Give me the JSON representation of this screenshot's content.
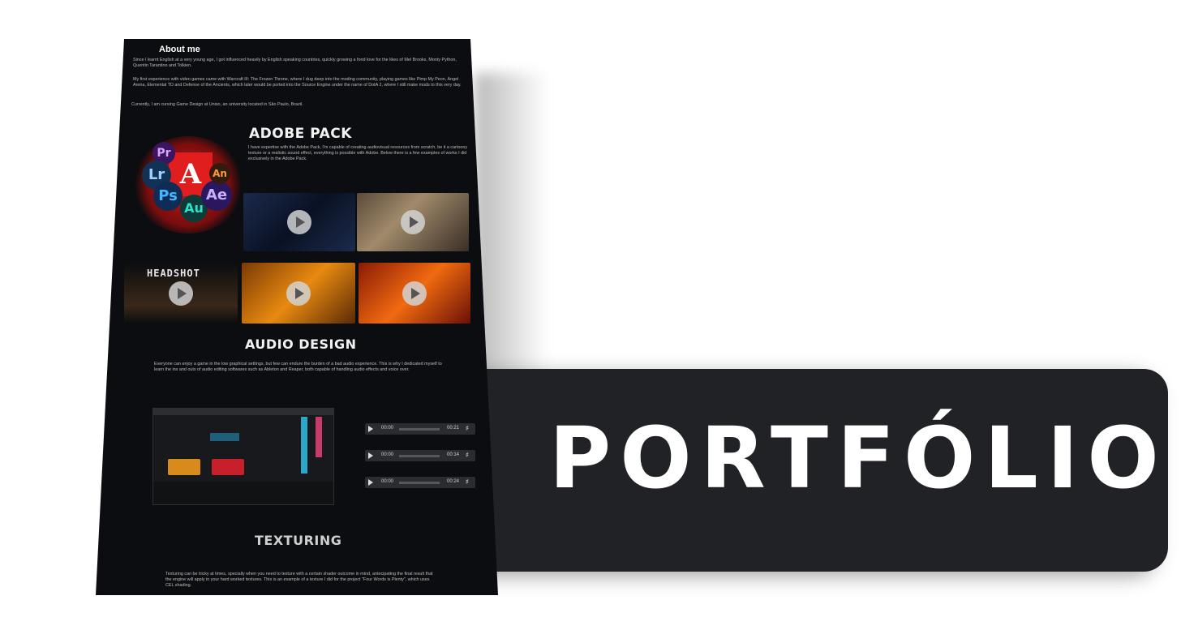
{
  "banner": {
    "title": "PORTFÓLIO"
  },
  "page": {
    "about": {
      "heading": "About me",
      "paragraphs": [
        "Since I learnt English at a very young age, I got influenced heavily by English speaking countries, quickly growing a fond love for the likes of Mel Brooks, Monty Python, Quentin Tarantino and Tolkien.",
        "My first experience with video games came with Warcraft III: The Frozen Throne, where I dug deep into the moding community, playing games like Pimp My Peon, Angel Arena, Elemental TD and Defense of the Ancients, which later would be ported into the Source Engine under the name of DotA 2, where I still make mods to this very day.",
        "Currently, I am cursing Game Design at Uniso, an university located in São Paulo, Brazil."
      ]
    },
    "adobe": {
      "heading": "ADOBE PACK",
      "text": "I have expertise with the Adobe Pack, I'm capable of creating audiovisual resources from scratch, be it a cartoony texture or a realistic sound effect, everything is possible with Adobe. Below there is a few examples of works I did exclusively in the Adobe Pack.",
      "apps": [
        "Pr",
        "Lr",
        "Ps",
        "Au",
        "Ae",
        "An"
      ],
      "thumb_labels": [
        "HEADSHOT"
      ]
    },
    "audio": {
      "heading": "AUDIO DESIGN",
      "text": "Everyone can enjoy a game in the low graphical settings, but few can endure the burden of a bad audio experience. This is why I dedicated myself to learn the ins and outs of audio editing softwares such as Ableton and Reaper, both capable of handling audio effects and voice over.",
      "players": [
        {
          "current": "00:00",
          "duration": "00:21"
        },
        {
          "current": "00:00",
          "duration": "00:14"
        },
        {
          "current": "00:00",
          "duration": "00:24"
        }
      ]
    },
    "texturing": {
      "heading": "TEXTURING",
      "text": "Texturing can be tricky at times, specially when you need to texture with a certain shader outcome in mind, antecipating the final result that the engine will apply in your hard worked textures. This is an example of a texture I did for the project \"Four Words is Plenty\", which uses CEL shading."
    }
  },
  "colors": {
    "page_bg": "#0b0d10",
    "banner_bg": "#202225",
    "adobe_red": "#e01e1e"
  }
}
